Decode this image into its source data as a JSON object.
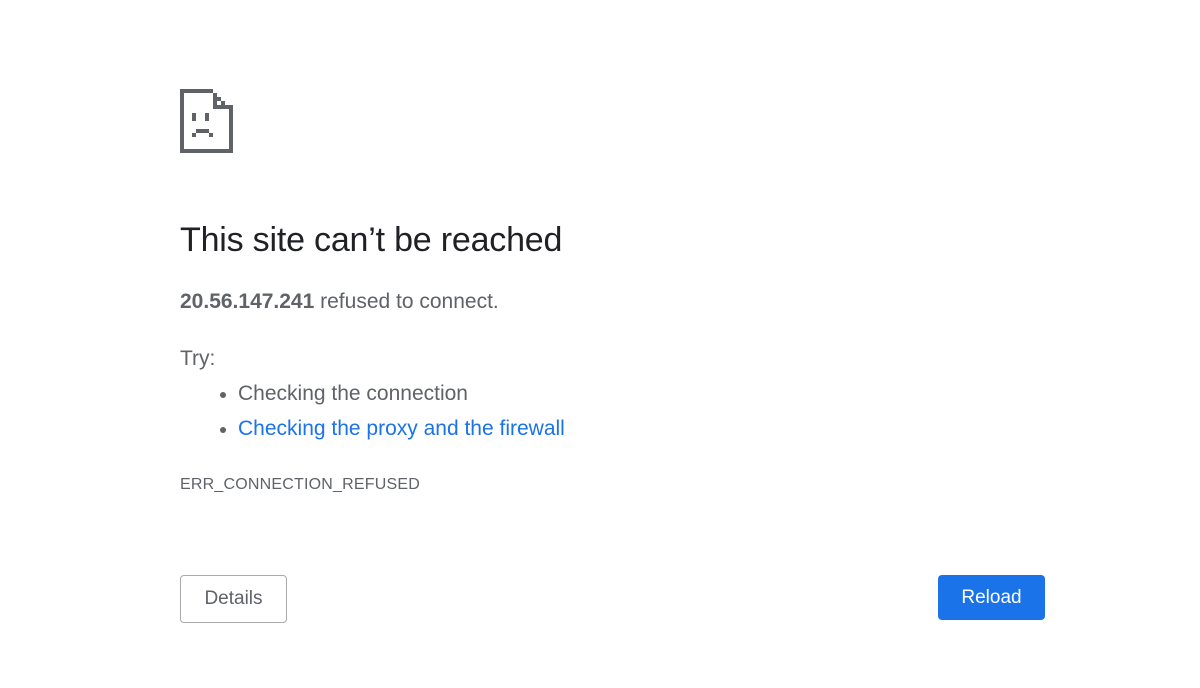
{
  "error": {
    "icon": "sad-page-icon",
    "title": "This site can’t be reached",
    "host": "20.56.147.241",
    "summary_suffix": " refused to connect.",
    "try_label": "Try:",
    "suggestions": [
      {
        "label": "Checking the connection",
        "is_link": false
      },
      {
        "label": "Checking the proxy and the firewall",
        "is_link": true
      }
    ],
    "code": "ERR_CONNECTION_REFUSED"
  },
  "buttons": {
    "details_label": "Details",
    "reload_label": "Reload"
  },
  "colors": {
    "text": "#5f6368",
    "title": "#202124",
    "link": "#1a73e8",
    "primary_button": "#1a73e8"
  }
}
